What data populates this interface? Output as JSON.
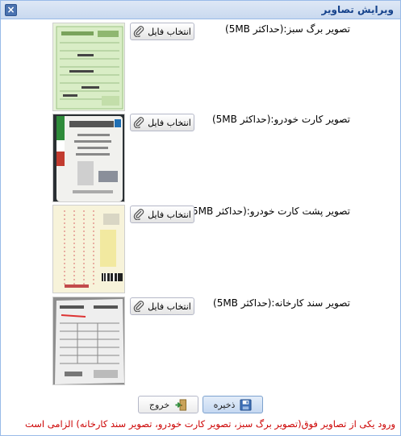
{
  "window": {
    "title": "ویرایش تصاویر",
    "close_label": "×"
  },
  "rows": [
    {
      "label": "تصویر برگ سبز:(حداکثر 5MB)",
      "button": "انتخاب فایل"
    },
    {
      "label": "تصویر کارت خودرو:(حداکثر 5MB)",
      "button": "انتخاب فایل"
    },
    {
      "label": "تصویر پشت کارت خودرو:(حداکثر 5MB)",
      "button": "انتخاب فایل"
    },
    {
      "label": "تصویر سند کارخانه:(حداکثر 5MB)",
      "button": "انتخاب فایل"
    }
  ],
  "actions": {
    "save_label": "ذخیره",
    "exit_label": "خروج"
  },
  "note": "ورود یکی از تصاویر فوق(تصویر برگ سبز، تصویر کارت خودرو، تصویر سند کارخانه) الزامی است",
  "colors": {
    "accent": "#15428b",
    "note": "#cc0000",
    "border": "#99bbe8"
  }
}
